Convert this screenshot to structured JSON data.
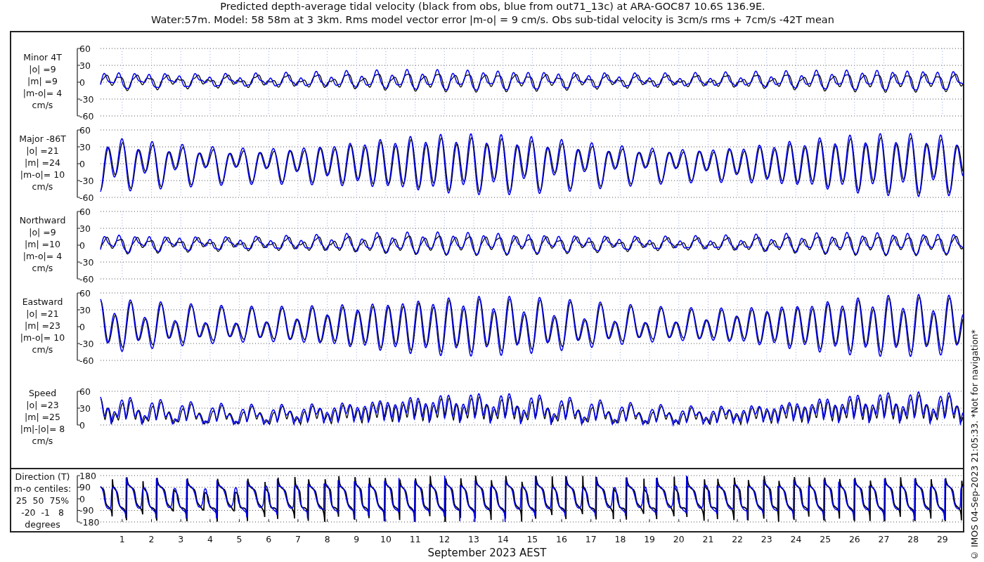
{
  "title_lines": [
    "Predicted depth-average tidal velocity (black from obs, blue from out71_13c) at ARA-GOC87 10.6S 136.9E.",
    "Water:57m. Model: 58 58m at 3 3km. Rms model vector error |m-o| = 9 cm/s. Obs sub-tidal velocity is 3cm/s rms + 7cm/s -42T mean"
  ],
  "panels": [
    {
      "kind": "minor",
      "label_lines": [
        "Minor 4T",
        "|o| =9",
        "|m| =9",
        "|m-o|= 4",
        "cm/s"
      ],
      "yticks": [
        "60",
        "30",
        "0",
        "-30",
        "-60"
      ]
    },
    {
      "kind": "major",
      "label_lines": [
        "Major -86T",
        "|o| =21",
        "|m| =24",
        "|m-o|= 10",
        "cm/s"
      ],
      "yticks": [
        "60",
        "30",
        "0",
        "-30",
        "-60"
      ]
    },
    {
      "kind": "northward",
      "label_lines": [
        "Northward",
        "|o| =9",
        "|m| =10",
        "|m-o|= 4",
        "cm/s"
      ],
      "yticks": [
        "60",
        "30",
        "0",
        "-30",
        "-60"
      ]
    },
    {
      "kind": "eastward",
      "label_lines": [
        "Eastward",
        "|o| =21",
        "|m| =23",
        "|m-o|= 10",
        "cm/s"
      ],
      "yticks": [
        "60",
        "30",
        "0",
        "-30",
        "-60"
      ]
    },
    {
      "kind": "speed",
      "label_lines": [
        "Speed",
        "|o| =23",
        "|m| =25",
        "|m|-|o|= 8",
        "cm/s"
      ],
      "yticks": [
        "60",
        "30",
        "0"
      ]
    }
  ],
  "direction_panel": {
    "kind": "direction",
    "label_lines": [
      "Direction (T)",
      "m-o centiles:",
      "25  50  75%",
      "-20  -1   8",
      "degrees"
    ],
    "yticks": [
      "180",
      "90",
      "0",
      "-90",
      "-180"
    ]
  },
  "xticks": [
    "1",
    "2",
    "3",
    "4",
    "5",
    "6",
    "7",
    "8",
    "9",
    "10",
    "11",
    "12",
    "13",
    "14",
    "15",
    "16",
    "17",
    "18",
    "19",
    "20",
    "21",
    "22",
    "23",
    "24",
    "25",
    "26",
    "27",
    "28",
    "29"
  ],
  "xlabel": "September 2023 AEST",
  "credit": "© IMOS 04-Sep-2023 21:05:33. *Not for navigation*"
}
